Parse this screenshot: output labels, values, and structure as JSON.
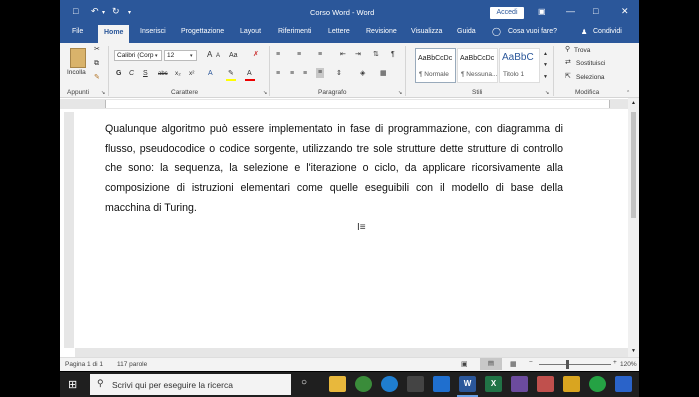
{
  "app": {
    "window_title": "Corso Word - Word",
    "sign_in": "Accedi",
    "tell_me": "Cosa vuoi fare?",
    "share": "Condividi"
  },
  "tabs": [
    "File",
    "Home",
    "Inserisci",
    "Progettazione",
    "Layout",
    "Riferimenti",
    "Lettere",
    "Revisione",
    "Visualizza",
    "Guida"
  ],
  "ribbon": {
    "clipboard": {
      "paste": "Incolla",
      "group": "Appunti"
    },
    "font": {
      "family": "Calibri (Corp",
      "size": "12",
      "grow": "A",
      "shrink": "A",
      "bold": "G",
      "italic": "C",
      "underline": "S",
      "strike": "abc",
      "subscript": "x₂",
      "superscript": "x²",
      "case": "Aa",
      "group": "Carattere"
    },
    "paragraph": {
      "group": "Paragrafo"
    },
    "styles": {
      "items": [
        {
          "sample": "AaBbCcDc",
          "name": "¶ Normale"
        },
        {
          "sample": "AaBbCcDc",
          "name": "¶ Nessuna..."
        },
        {
          "sample": "AaBbC",
          "name": "Titolo 1"
        }
      ],
      "group": "Stili"
    },
    "editing": {
      "find": "Trova",
      "replace": "Sostituisci",
      "select": "Seleziona",
      "group": "Modifica"
    }
  },
  "document": {
    "text": "Qualunque algoritmo può essere implementato in fase di programmazione, con diagramma di flusso, pseudocodice o codice sorgente, utilizzando tre sole strutture dette strutture di controllo che sono: la sequenza, la selezione e l'iterazione o ciclo, da applicare ricorsivamente alla composizione di istruzioni elementari come quelle eseguibili con il modello di base della macchina di Turing."
  },
  "status": {
    "page": "Pagina 1 di 1",
    "words": "117 parole",
    "zoom": "120%"
  },
  "taskbar": {
    "search_placeholder": "Scrivi qui per eseguire la ricerca"
  }
}
